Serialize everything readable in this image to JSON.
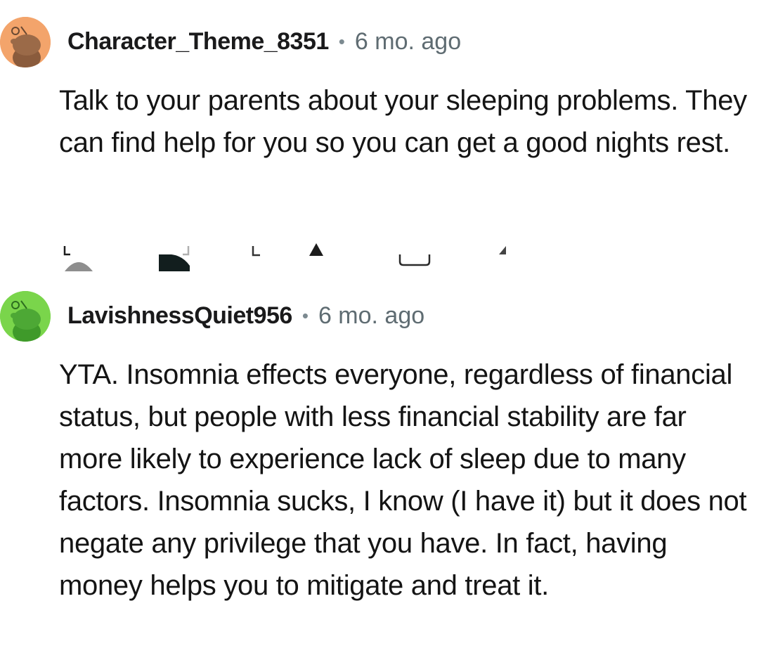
{
  "comments": [
    {
      "username": "Character_Theme_8351",
      "separator": "•",
      "time": "6 mo. ago",
      "text": "Talk to your parents about your sleeping problems. They can find help for you so you can get a good nights rest.",
      "avatar_color": "#f3a46b"
    },
    {
      "username": "LavishnessQuiet956",
      "separator": "•",
      "time": "6 mo. ago",
      "text": "YTA. Insomnia effects everyone, regardless of financial status, but people with less financial stability are far more likely to experience lack of sleep due to many factors. Insomnia sucks, I know (I have it) but it does not negate any privilege that you have. In fact, having money helps you to mitigate and treat it.",
      "avatar_color": "#7ad54b"
    }
  ],
  "action_icons": [
    "reply-icon",
    "award-icon",
    "share-icon",
    "upvote-icon",
    "comment-icon",
    "more-icon"
  ]
}
